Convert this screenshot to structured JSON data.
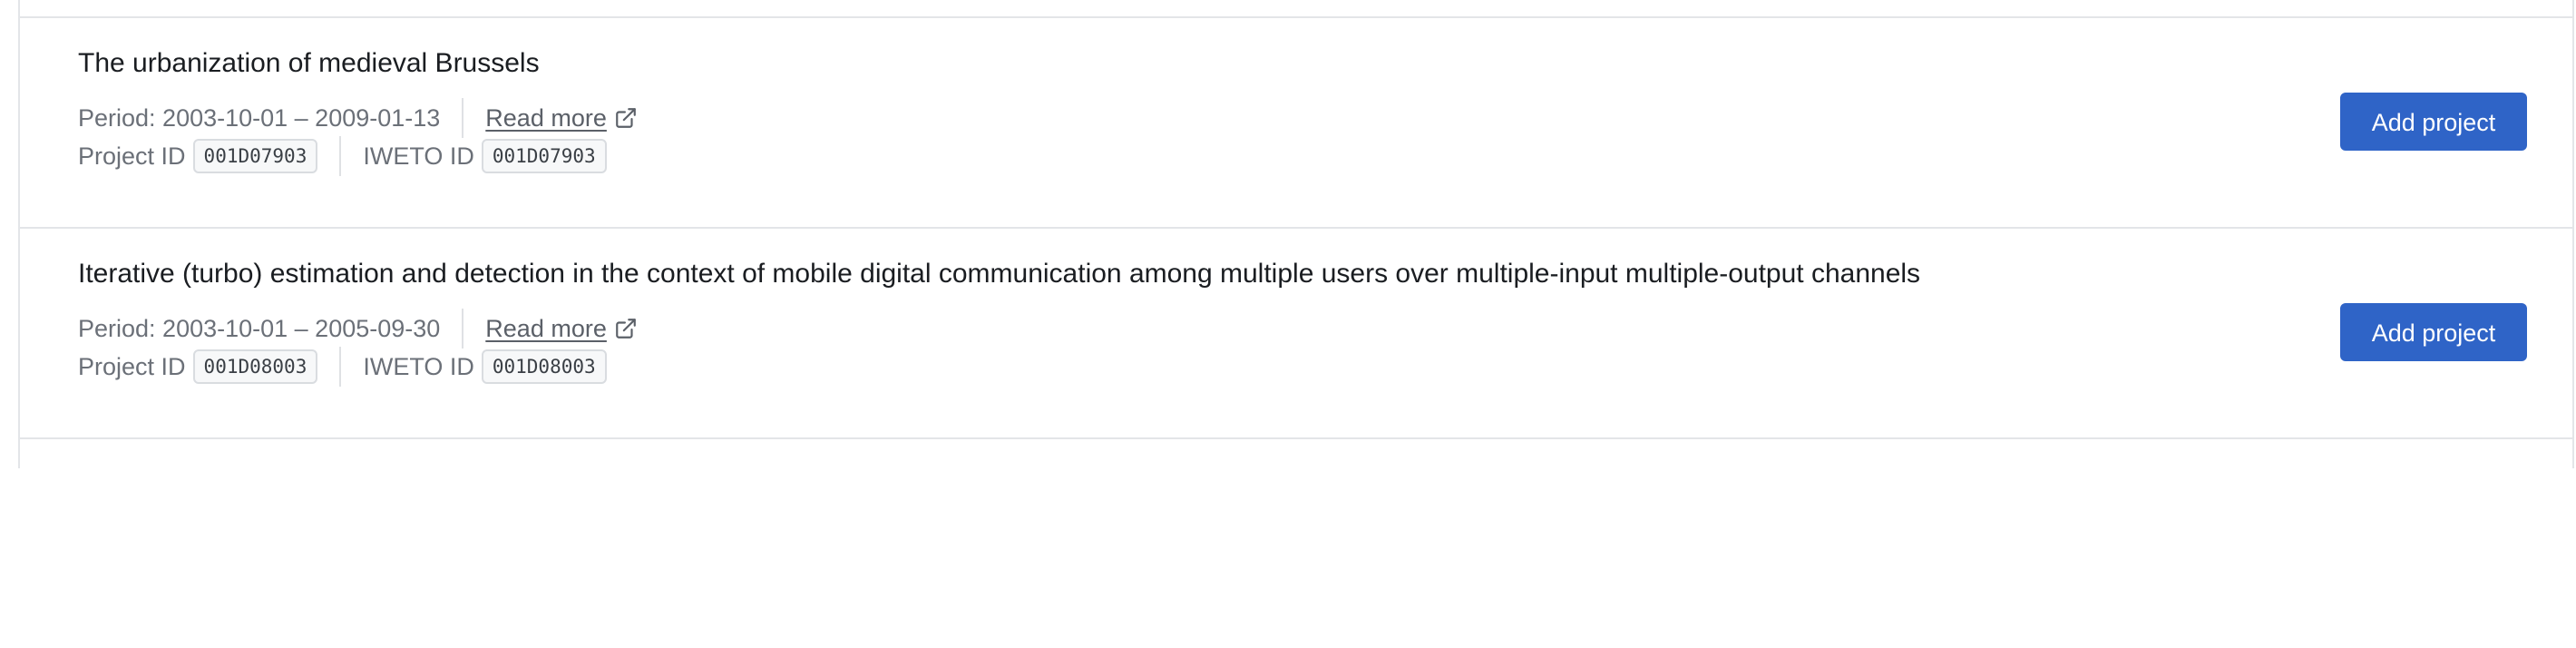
{
  "projects": [
    {
      "title": "The urbanization of medieval Brussels",
      "period": "Period: 2003-10-01 – 2009-01-13",
      "read_more": "Read more",
      "project_id_label": "Project ID",
      "project_id": "001D07903",
      "iweto_id_label": "IWETO ID",
      "iweto_id": "001D07903",
      "add_button": "Add project"
    },
    {
      "title": "Iterative (turbo) estimation and detection in the context of mobile digital communication among multiple users over multiple-input multiple-output channels",
      "period": "Period: 2003-10-01 – 2005-09-30",
      "read_more": "Read more",
      "project_id_label": "Project ID",
      "project_id": "001D08003",
      "iweto_id_label": "IWETO ID",
      "iweto_id": "001D08003",
      "add_button": "Add project"
    }
  ],
  "icons": {
    "external_link": "external-link-icon"
  },
  "colors": {
    "primary_button": "#2f64c7",
    "border": "#e3e5e8",
    "muted_text": "#6b7078"
  }
}
